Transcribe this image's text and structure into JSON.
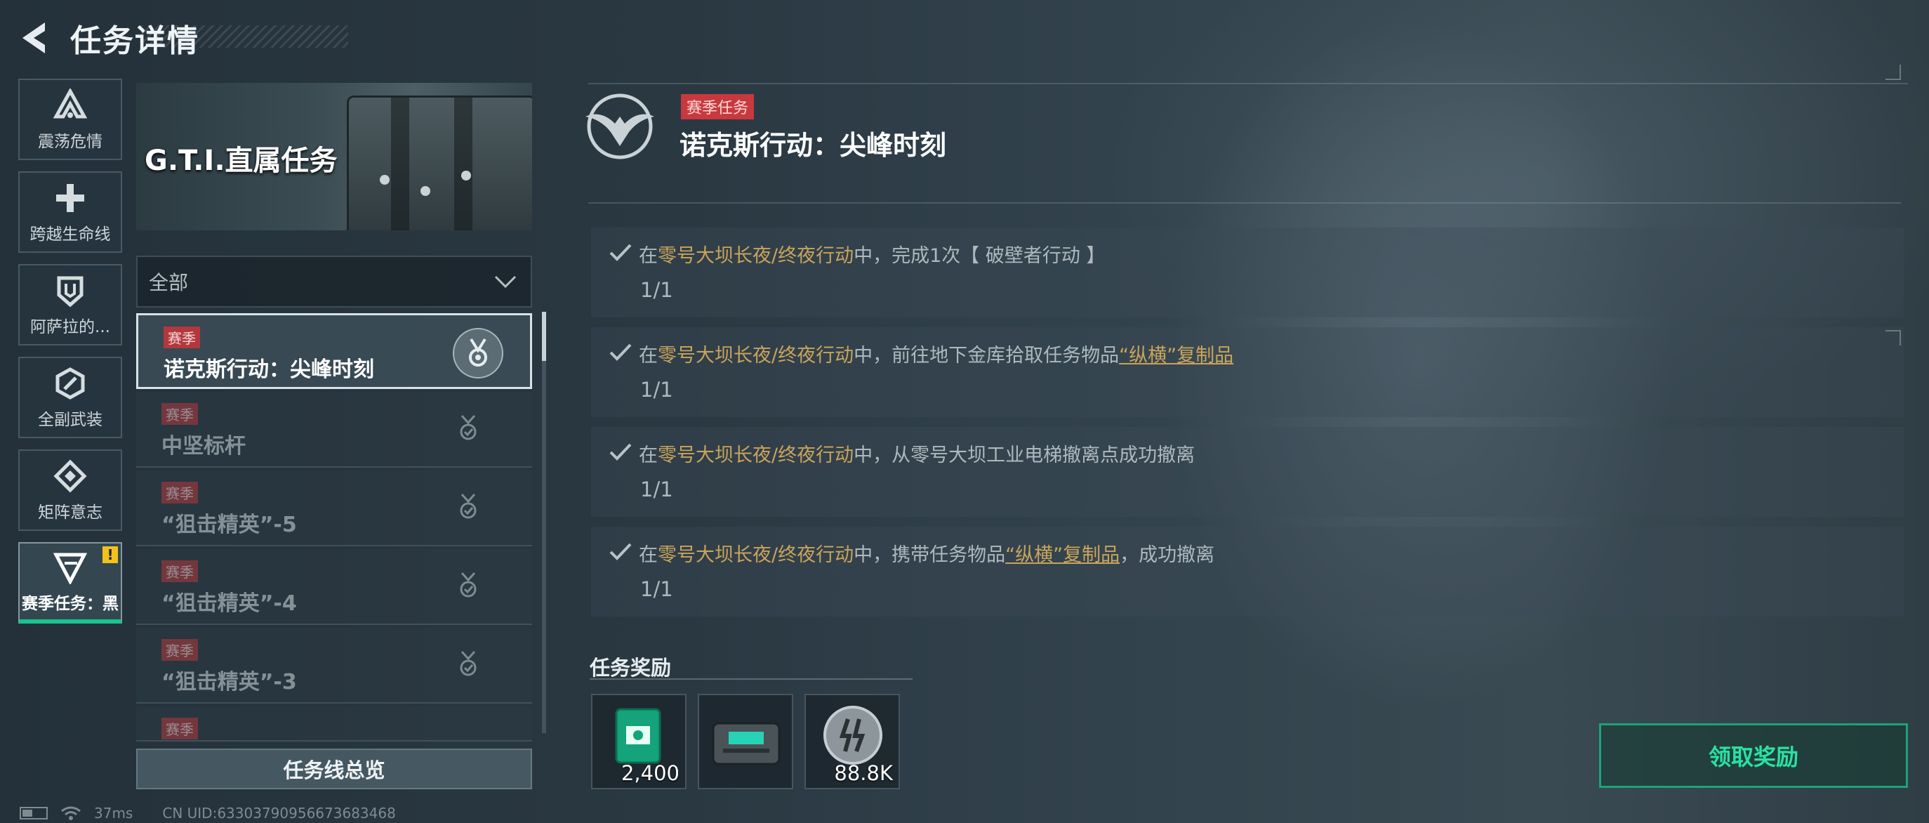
{
  "header": {
    "title": "任务详情",
    "back_icon": "chevron-left-icon"
  },
  "sidebar": {
    "items": [
      {
        "label": "震荡危情",
        "icon": "delta-a-icon"
      },
      {
        "label": "跨越生命线",
        "icon": "plus-cross-icon"
      },
      {
        "label": "阿萨拉的...",
        "icon": "shield-icon"
      },
      {
        "label": "全副武装",
        "icon": "hexagon-link-icon"
      },
      {
        "label": "矩阵意志",
        "icon": "diamond-matrix-icon"
      },
      {
        "label": "赛季任务：黑",
        "icon": "gti-v-icon",
        "active": true,
        "alert": "!"
      }
    ]
  },
  "banner": {
    "title": "G.T.I.直属任务"
  },
  "filter": {
    "selected": "全部"
  },
  "tasks": [
    {
      "tag": "赛季",
      "name": "诺克斯行动：尖峰时刻",
      "active": true
    },
    {
      "tag": "赛季",
      "name": "中坚标杆"
    },
    {
      "tag": "赛季",
      "name": "“狙击精英”-5"
    },
    {
      "tag": "赛季",
      "name": "“狙击精英”-4"
    },
    {
      "tag": "赛季",
      "name": "“狙击精英”-3"
    },
    {
      "tag": "赛季",
      "name": ""
    }
  ],
  "overview_button": "任务线总览",
  "status_bar": {
    "ping": "37ms",
    "uid": "CN UID:6330379095667368346​8"
  },
  "detail": {
    "tag": "赛季任务",
    "title": "诺克斯行动：尖峰时刻",
    "objectives": [
      {
        "pre": "在",
        "map": "零号大坝长夜/终夜行动",
        "mid": "中，完成1次【 破壁者行动 】",
        "item": "",
        "post": "",
        "progress": "1/1"
      },
      {
        "pre": "在",
        "map": "零号大坝长夜/终夜行动",
        "mid": "中，前往地下金库拾取任务物品",
        "item": "“纵横”复制品",
        "post": "",
        "progress": "1/1"
      },
      {
        "pre": "在",
        "map": "零号大坝长夜/终夜行动",
        "mid": "中，从零号大坝工业电梯撤离点成功撤离",
        "item": "",
        "post": "",
        "progress": "1/1"
      },
      {
        "pre": "在",
        "map": "零号大坝长夜/终夜行动",
        "mid": "中，携带任务物品",
        "item": "“纵横”复制品",
        "post": "，成功撤离",
        "progress": "1/1"
      }
    ],
    "rewards_title": "任务奖励",
    "rewards": [
      {
        "icon": "green-credit-card-icon",
        "amount": "2,400"
      },
      {
        "icon": "supply-crate-icon",
        "amount": ""
      },
      {
        "icon": "silver-coin-icon",
        "amount": "88.8K"
      }
    ],
    "claim_button": "领取奖励"
  },
  "colors": {
    "accent_green": "#28e2a2",
    "season_red": "#c7393e",
    "map_gold": "#c9a45a"
  }
}
